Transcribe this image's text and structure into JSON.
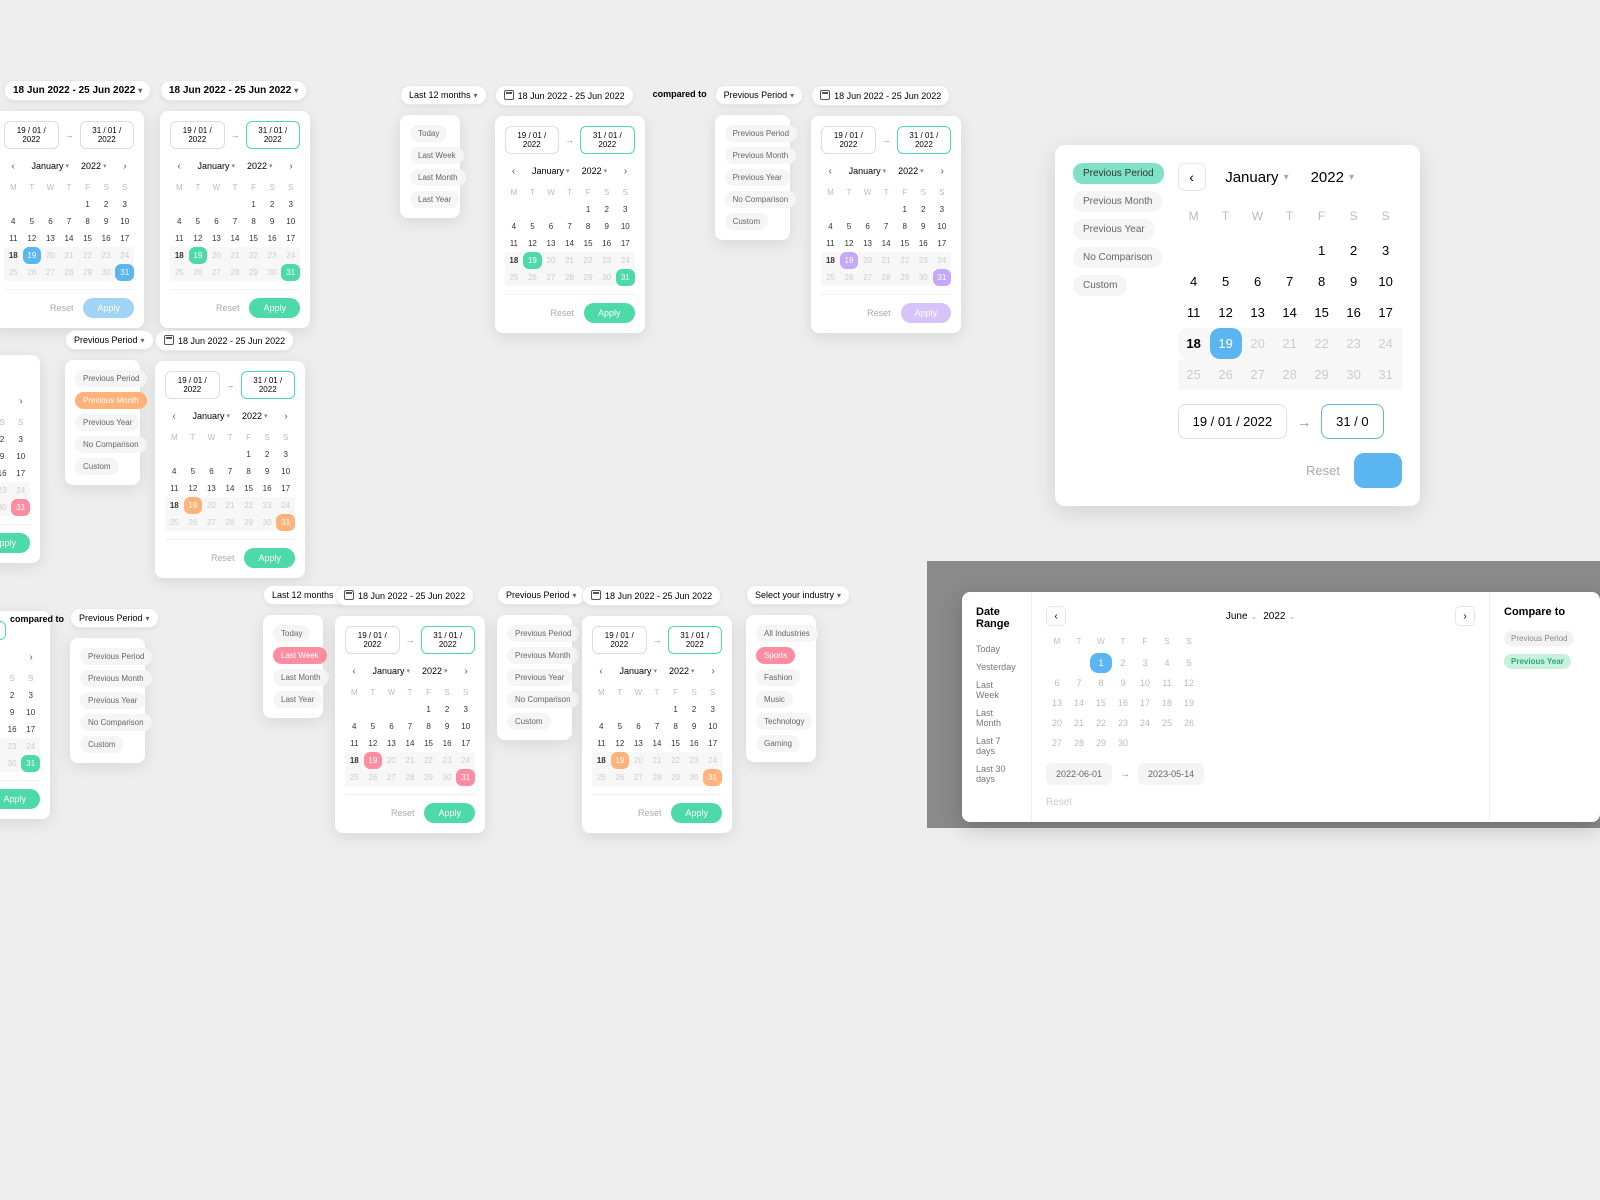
{
  "common": {
    "date_range_label": "18 Jun 2022 - 25 Jun 2022",
    "start_date": "19 / 01 / 2022",
    "end_date": "31 / 01 / 2022",
    "month": "January",
    "year": "2022",
    "reset": "Reset",
    "apply": "Apply",
    "prev_period": "Previous Period",
    "compared_to": "compared to",
    "last12": "Last 12 months"
  },
  "dow": [
    "M",
    "T",
    "W",
    "T",
    "F",
    "S",
    "S"
  ],
  "presets_main": [
    "Today",
    "Last Week",
    "Last Month",
    "Last Year"
  ],
  "presets_compare": [
    "Previous Period",
    "Previous Month",
    "Previous Year",
    "No Comparison",
    "Custom"
  ],
  "presets_industry": {
    "title": "Select your industry",
    "items": [
      "All Industries",
      "Sports",
      "Fashion",
      "Music",
      "Technology",
      "Gaming"
    ]
  },
  "big": {
    "month": "January",
    "year": "2022",
    "dow": [
      "M",
      "T",
      "W",
      "T",
      "F",
      "S",
      "S"
    ],
    "start": "19 / 01 / 2022",
    "end": "31 / 0",
    "reset": "Reset"
  },
  "big_presets": [
    "Previous Period",
    "Previous Month",
    "Previous Year",
    "No Comparison",
    "Custom"
  ],
  "modal": {
    "date_range_title": "Date Range",
    "compare_title": "Compare to",
    "presets": [
      "Today",
      "Yesterday",
      "Last Week",
      "Last Month",
      "Last 7 days",
      "Last 30 days"
    ],
    "compare_presets": [
      "Previous Period",
      "Previous Year"
    ],
    "month": "June",
    "year": "2022",
    "dow": [
      "M",
      "T",
      "W",
      "T",
      "F",
      "S",
      "S"
    ],
    "start": "2022-06-01",
    "end": "2023-05-14",
    "reset": "Reset"
  }
}
